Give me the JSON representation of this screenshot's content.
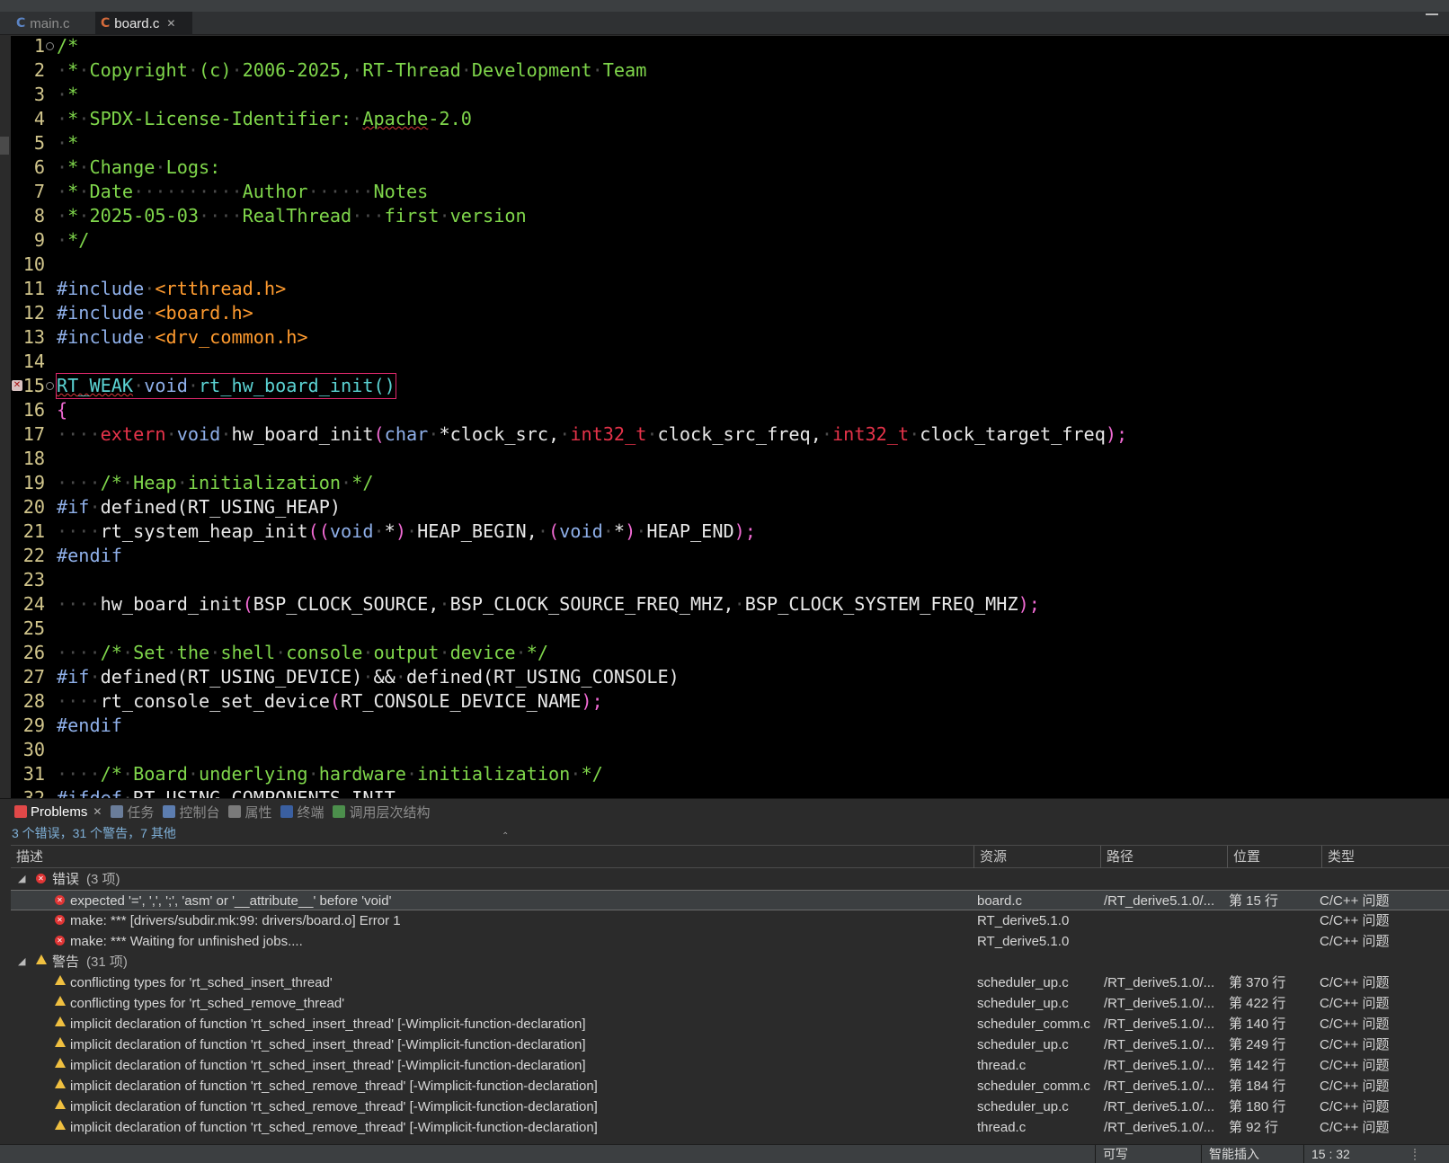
{
  "editor_tabs": [
    {
      "label": "main.c",
      "active": false
    },
    {
      "label": "board.c",
      "active": true
    }
  ],
  "code_lines": [
    {
      "n": "1",
      "fold": true,
      "parts": [
        [
          "cm",
          "/*"
        ]
      ]
    },
    {
      "n": "2",
      "parts": [
        [
          "ws",
          "·"
        ],
        [
          "cm",
          "*"
        ],
        [
          "ws",
          "·"
        ],
        [
          "cm",
          "Copyright"
        ],
        [
          "ws",
          "·"
        ],
        [
          "cm",
          "(c)"
        ],
        [
          "ws",
          "·"
        ],
        [
          "cm",
          "2006-2025,"
        ],
        [
          "ws",
          "·"
        ],
        [
          "cm",
          "RT-Thread"
        ],
        [
          "ws",
          "·"
        ],
        [
          "cm",
          "Development"
        ],
        [
          "ws",
          "·"
        ],
        [
          "cm",
          "Team"
        ]
      ]
    },
    {
      "n": "3",
      "parts": [
        [
          "ws",
          "·"
        ],
        [
          "cm",
          "*"
        ]
      ]
    },
    {
      "n": "4",
      "parts": [
        [
          "ws",
          "·"
        ],
        [
          "cm",
          "*"
        ],
        [
          "ws",
          "·"
        ],
        [
          "cm",
          "SPDX-License-Identifier:"
        ],
        [
          "ws",
          "·"
        ],
        [
          "cm squig",
          "Apache"
        ],
        [
          "cm",
          "-2.0"
        ]
      ]
    },
    {
      "n": "5",
      "parts": [
        [
          "ws",
          "·"
        ],
        [
          "cm",
          "*"
        ]
      ]
    },
    {
      "n": "6",
      "parts": [
        [
          "ws",
          "·"
        ],
        [
          "cm",
          "*"
        ],
        [
          "ws",
          "·"
        ],
        [
          "cm",
          "Change"
        ],
        [
          "ws",
          "·"
        ],
        [
          "cm",
          "Logs:"
        ]
      ]
    },
    {
      "n": "7",
      "parts": [
        [
          "ws",
          "·"
        ],
        [
          "cm",
          "*"
        ],
        [
          "ws",
          "·"
        ],
        [
          "cm",
          "Date"
        ],
        [
          "ws",
          "··········"
        ],
        [
          "cm",
          "Author"
        ],
        [
          "ws",
          "······"
        ],
        [
          "cm",
          "Notes"
        ]
      ]
    },
    {
      "n": "8",
      "parts": [
        [
          "ws",
          "·"
        ],
        [
          "cm",
          "*"
        ],
        [
          "ws",
          "·"
        ],
        [
          "cm",
          "2025-05-03"
        ],
        [
          "ws",
          "····"
        ],
        [
          "cm",
          "RealThread"
        ],
        [
          "ws",
          "···"
        ],
        [
          "cm",
          "first"
        ],
        [
          "ws",
          "·"
        ],
        [
          "cm",
          "version"
        ]
      ]
    },
    {
      "n": "9",
      "parts": [
        [
          "ws",
          "·"
        ],
        [
          "cm",
          "*/"
        ]
      ]
    },
    {
      "n": "10",
      "parts": []
    },
    {
      "n": "11",
      "parts": [
        [
          "pp",
          "#include"
        ],
        [
          "ws",
          "·"
        ],
        [
          "inc",
          "<rtthread.h>"
        ]
      ]
    },
    {
      "n": "12",
      "parts": [
        [
          "pp",
          "#include"
        ],
        [
          "ws",
          "·"
        ],
        [
          "inc",
          "<board.h>"
        ]
      ]
    },
    {
      "n": "13",
      "parts": [
        [
          "pp",
          "#include"
        ],
        [
          "ws",
          "·"
        ],
        [
          "inc",
          "<drv_common.h>"
        ]
      ]
    },
    {
      "n": "14",
      "parts": []
    },
    {
      "n": "15",
      "fold": true,
      "error": true,
      "current": true,
      "parts": [
        [
          "tl squig",
          "RT_WEAK"
        ],
        [
          "ws",
          "·"
        ],
        [
          "kw",
          "void"
        ],
        [
          "ws",
          "·"
        ],
        [
          "tl",
          "rt_hw_board_init()"
        ]
      ]
    },
    {
      "n": "16",
      "parts": [
        [
          "br",
          "{"
        ]
      ]
    },
    {
      "n": "17",
      "parts": [
        [
          "ws",
          "····"
        ],
        [
          "ty",
          "extern"
        ],
        [
          "ws",
          "·"
        ],
        [
          "kw",
          "void"
        ],
        [
          "ws",
          "·"
        ],
        [
          "tx",
          "hw_board_init"
        ],
        [
          "br",
          "("
        ],
        [
          "kw",
          "char"
        ],
        [
          "ws",
          "·"
        ],
        [
          "tx",
          "*clock_src,"
        ],
        [
          "ws",
          "·"
        ],
        [
          "ty",
          "int32_t"
        ],
        [
          "ws",
          "·"
        ],
        [
          "tx",
          "clock_src_freq,"
        ],
        [
          "ws",
          "·"
        ],
        [
          "ty",
          "int32_t"
        ],
        [
          "ws",
          "·"
        ],
        [
          "tx",
          "clock_target_freq"
        ],
        [
          "br",
          ");"
        ]
      ]
    },
    {
      "n": "18",
      "parts": []
    },
    {
      "n": "19",
      "parts": [
        [
          "ws",
          "····"
        ],
        [
          "cm",
          "/*"
        ],
        [
          "ws",
          "·"
        ],
        [
          "cm",
          "Heap"
        ],
        [
          "ws",
          "·"
        ],
        [
          "cm",
          "initialization"
        ],
        [
          "ws",
          "·"
        ],
        [
          "cm",
          "*/"
        ]
      ]
    },
    {
      "n": "20",
      "parts": [
        [
          "pp",
          "#if"
        ],
        [
          "ws",
          "·"
        ],
        [
          "tx",
          "defined(RT_USING_HEAP)"
        ]
      ]
    },
    {
      "n": "21",
      "parts": [
        [
          "ws",
          "····"
        ],
        [
          "tx",
          "rt_system_heap_init"
        ],
        [
          "br",
          "(("
        ],
        [
          "kw",
          "void"
        ],
        [
          "ws",
          "·"
        ],
        [
          "tx",
          "*"
        ],
        [
          "br",
          ")"
        ],
        [
          "ws",
          "·"
        ],
        [
          "tx",
          "HEAP_BEGIN,"
        ],
        [
          "ws",
          "·"
        ],
        [
          "br",
          "("
        ],
        [
          "kw",
          "void"
        ],
        [
          "ws",
          "·"
        ],
        [
          "tx",
          "*"
        ],
        [
          "br",
          ")"
        ],
        [
          "ws",
          "·"
        ],
        [
          "tx",
          "HEAP_END"
        ],
        [
          "br",
          ");"
        ]
      ]
    },
    {
      "n": "22",
      "parts": [
        [
          "pp",
          "#endif"
        ]
      ]
    },
    {
      "n": "23",
      "parts": []
    },
    {
      "n": "24",
      "parts": [
        [
          "ws",
          "····"
        ],
        [
          "tx",
          "hw_board_init"
        ],
        [
          "br",
          "("
        ],
        [
          "tx",
          "BSP_CLOCK_SOURCE,"
        ],
        [
          "ws",
          "·"
        ],
        [
          "tx",
          "BSP_CLOCK_SOURCE_FREQ_MHZ,"
        ],
        [
          "ws",
          "·"
        ],
        [
          "tx",
          "BSP_CLOCK_SYSTEM_FREQ_MHZ"
        ],
        [
          "br",
          ");"
        ]
      ]
    },
    {
      "n": "25",
      "parts": []
    },
    {
      "n": "26",
      "parts": [
        [
          "ws",
          "····"
        ],
        [
          "cm",
          "/*"
        ],
        [
          "ws",
          "·"
        ],
        [
          "cm",
          "Set"
        ],
        [
          "ws",
          "·"
        ],
        [
          "cm",
          "the"
        ],
        [
          "ws",
          "·"
        ],
        [
          "cm",
          "shell"
        ],
        [
          "ws",
          "·"
        ],
        [
          "cm",
          "console"
        ],
        [
          "ws",
          "·"
        ],
        [
          "cm",
          "output"
        ],
        [
          "ws",
          "·"
        ],
        [
          "cm",
          "device"
        ],
        [
          "ws",
          "·"
        ],
        [
          "cm",
          "*/"
        ]
      ]
    },
    {
      "n": "27",
      "parts": [
        [
          "pp",
          "#if"
        ],
        [
          "ws",
          "·"
        ],
        [
          "tx",
          "defined(RT_USING_DEVICE)"
        ],
        [
          "ws",
          "·"
        ],
        [
          "tx",
          "&&"
        ],
        [
          "ws",
          "·"
        ],
        [
          "tx",
          "defined(RT_USING_CONSOLE)"
        ]
      ]
    },
    {
      "n": "28",
      "parts": [
        [
          "ws",
          "····"
        ],
        [
          "tx",
          "rt_console_set_device"
        ],
        [
          "br",
          "("
        ],
        [
          "tx",
          "RT_CONSOLE_DEVICE_NAME"
        ],
        [
          "br",
          ");"
        ]
      ]
    },
    {
      "n": "29",
      "parts": [
        [
          "pp",
          "#endif"
        ]
      ]
    },
    {
      "n": "30",
      "parts": []
    },
    {
      "n": "31",
      "parts": [
        [
          "ws",
          "····"
        ],
        [
          "cm",
          "/*"
        ],
        [
          "ws",
          "·"
        ],
        [
          "cm",
          "Board"
        ],
        [
          "ws",
          "·"
        ],
        [
          "cm",
          "underlying"
        ],
        [
          "ws",
          "·"
        ],
        [
          "cm",
          "hardware"
        ],
        [
          "ws",
          "·"
        ],
        [
          "cm",
          "initialization"
        ],
        [
          "ws",
          "·"
        ],
        [
          "cm",
          "*/"
        ]
      ]
    },
    {
      "n": "32",
      "parts": [
        [
          "pp",
          "#ifdef"
        ],
        [
          "ws",
          "·"
        ],
        [
          "tx",
          "RT_USING_COMPONENTS_INIT"
        ]
      ]
    }
  ],
  "panel": {
    "tabs": [
      {
        "label": "Problems",
        "active": true,
        "icon": "problems-icon",
        "color": "#e04848"
      },
      {
        "label": "任务",
        "active": false,
        "icon": "tasks-icon",
        "color": "#6a7d9a"
      },
      {
        "label": "控制台",
        "active": false,
        "icon": "console-icon",
        "color": "#5c7db0"
      },
      {
        "label": "属性",
        "active": false,
        "icon": "properties-icon",
        "color": "#7a7a7a"
      },
      {
        "label": "终端",
        "active": false,
        "icon": "terminal-icon",
        "color": "#3a5fa0"
      },
      {
        "label": "调用层次结构",
        "active": false,
        "icon": "call-hierarchy-icon",
        "color": "#4c8f4c"
      }
    ],
    "summary": "3 个错误，31 个警告，7 其他",
    "columns": [
      "描述",
      "资源",
      "路径",
      "位置",
      "类型"
    ],
    "groups": [
      {
        "kind": "error",
        "label": "错误",
        "count": "(3 项)",
        "items": [
          {
            "desc": "expected '=', ',', ';', 'asm' or '__attribute__' before 'void'",
            "resource": "board.c",
            "path": "/RT_derive5.1.0/...",
            "location": "第 15 行",
            "type": "C/C++ 问题",
            "selected": true
          },
          {
            "desc": "make: *** [drivers/subdir.mk:99: drivers/board.o] Error 1",
            "resource": "RT_derive5.1.0",
            "path": "",
            "location": "",
            "type": "C/C++ 问题"
          },
          {
            "desc": "make: *** Waiting for unfinished jobs....",
            "resource": "RT_derive5.1.0",
            "path": "",
            "location": "",
            "type": "C/C++ 问题"
          }
        ]
      },
      {
        "kind": "warning",
        "label": "警告",
        "count": "(31 项)",
        "items": [
          {
            "desc": "conflicting types for 'rt_sched_insert_thread'",
            "resource": "scheduler_up.c",
            "path": "/RT_derive5.1.0/...",
            "location": "第 370 行",
            "type": "C/C++ 问题"
          },
          {
            "desc": "conflicting types for 'rt_sched_remove_thread'",
            "resource": "scheduler_up.c",
            "path": "/RT_derive5.1.0/...",
            "location": "第 422 行",
            "type": "C/C++ 问题"
          },
          {
            "desc": "implicit declaration of function 'rt_sched_insert_thread' [-Wimplicit-function-declaration]",
            "resource": "scheduler_comm.c",
            "path": "/RT_derive5.1.0/...",
            "location": "第 140 行",
            "type": "C/C++ 问题"
          },
          {
            "desc": "implicit declaration of function 'rt_sched_insert_thread' [-Wimplicit-function-declaration]",
            "resource": "scheduler_up.c",
            "path": "/RT_derive5.1.0/...",
            "location": "第 249 行",
            "type": "C/C++ 问题"
          },
          {
            "desc": "implicit declaration of function 'rt_sched_insert_thread' [-Wimplicit-function-declaration]",
            "resource": "thread.c",
            "path": "/RT_derive5.1.0/...",
            "location": "第 142 行",
            "type": "C/C++ 问题"
          },
          {
            "desc": "implicit declaration of function 'rt_sched_remove_thread' [-Wimplicit-function-declaration]",
            "resource": "scheduler_comm.c",
            "path": "/RT_derive5.1.0/...",
            "location": "第 184 行",
            "type": "C/C++ 问题"
          },
          {
            "desc": "implicit declaration of function 'rt_sched_remove_thread' [-Wimplicit-function-declaration]",
            "resource": "scheduler_up.c",
            "path": "/RT_derive5.1.0/...",
            "location": "第 180 行",
            "type": "C/C++ 问题"
          },
          {
            "desc": "implicit declaration of function 'rt_sched_remove_thread' [-Wimplicit-function-declaration]",
            "resource": "thread.c",
            "path": "/RT_derive5.1.0/...",
            "location": "第 92 行",
            "type": "C/C++ 问题"
          }
        ]
      }
    ]
  },
  "status": {
    "writable": "可写",
    "insert_mode": "智能插入",
    "cursor": "15 : 32"
  }
}
